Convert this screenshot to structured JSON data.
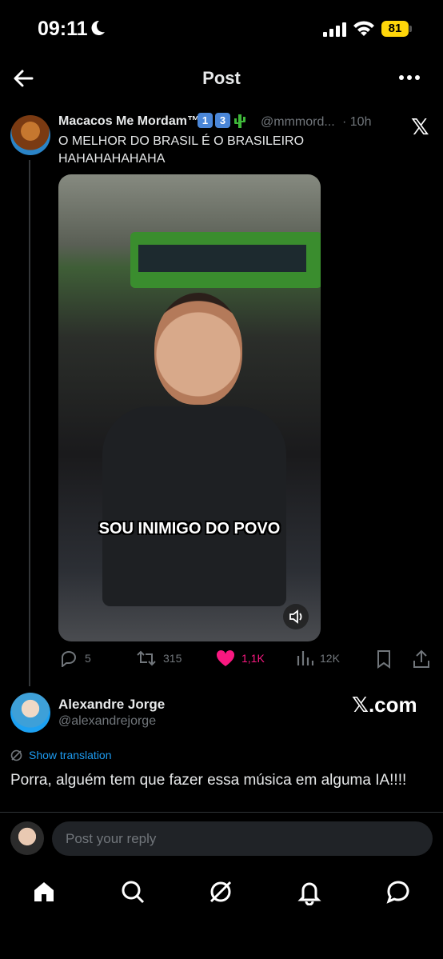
{
  "status_bar": {
    "time": "09:11",
    "battery": "81"
  },
  "header": {
    "title": "Post"
  },
  "quoted_post": {
    "author_name": "Macacos Me Mordam™",
    "badges": [
      "1",
      "3"
    ],
    "handle": "@mmmord...",
    "time": "· 10h",
    "text": "O MELHOR DO BRASIL É O BRASILEIRO HAHAHAHAHAHA",
    "media_caption": "SOU INIMIGO DO POVO",
    "x_logo": "𝕏",
    "actions": {
      "replies": "5",
      "reposts": "315",
      "likes": "1,1K",
      "views": "12K"
    }
  },
  "reply_post": {
    "author_name": "Alexandre Jorge",
    "handle": "@alexandrejorge",
    "watermark": "𝕏.com",
    "show_translation": "Show translation",
    "text": "Porra, alguém tem que fazer essa música em alguma IA!!!!"
  },
  "composer": {
    "placeholder": "Post your reply"
  },
  "colors": {
    "like": "#f91880",
    "link": "#1d9bf0",
    "battery": "#ffd60a"
  }
}
